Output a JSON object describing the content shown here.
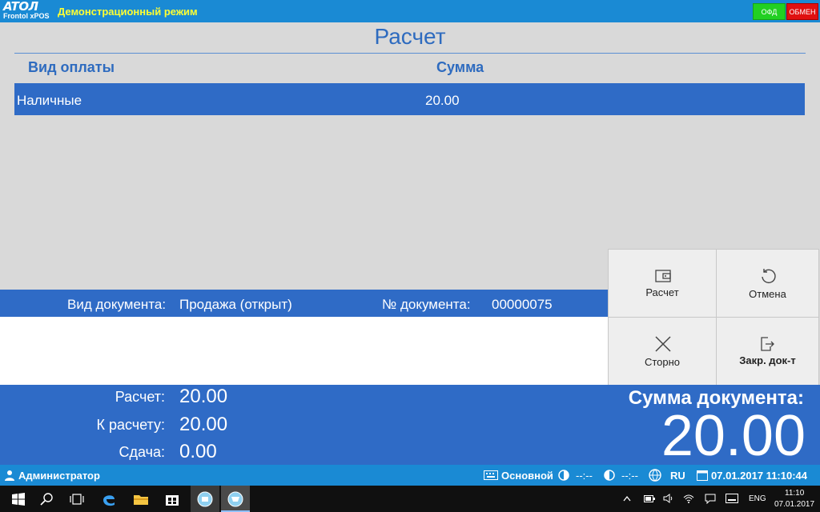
{
  "header": {
    "logo_main": "ATOЛ",
    "logo_sub": "Frontol xPOS",
    "mode": "Демонстрационный режим",
    "ofd_label": "ОФД",
    "obmen_label": "ОБМЕН",
    "colors": {
      "bar": "#1a8ad4",
      "mode_text": "#ffff33",
      "ofd": "#22d022",
      "obmen": "#e01010"
    }
  },
  "payment": {
    "title": "Расчет",
    "columns": [
      "Вид оплаты",
      "Сумма"
    ],
    "rows": [
      {
        "type": "Наличные",
        "amount": "20.00",
        "selected": true
      }
    ]
  },
  "document": {
    "type_label": "Вид документа:",
    "type_value": "Продажа (открыт)",
    "number_label": "№ документа:",
    "number_value": "00000075"
  },
  "actions": {
    "calc": {
      "label": "Расчет",
      "icon": "wallet-icon"
    },
    "cancel": {
      "label": "Отмена",
      "icon": "undo-icon"
    },
    "storno": {
      "label": "Сторно",
      "icon": "close-icon"
    },
    "close_doc": {
      "label": "Закр. док-т",
      "icon": "close-document-icon"
    }
  },
  "totals": {
    "calc_label": "Расчет:",
    "calc_value": "20.00",
    "due_label": "К расчету:",
    "due_value": "20.00",
    "change_label": "Сдача:",
    "change_value": "0.00",
    "doc_sum_label": "Сумма документа:",
    "doc_sum_value": "20.00"
  },
  "status": {
    "user": "Администратор",
    "keyboard_layout": "Основной",
    "timer1": "--:--",
    "timer2": "--:--",
    "lang": "RU",
    "datetime": "07.01.2017 11:10:44"
  },
  "taskbar": {
    "lang": "ENG",
    "time": "11:10",
    "date": "07.01.2017"
  }
}
